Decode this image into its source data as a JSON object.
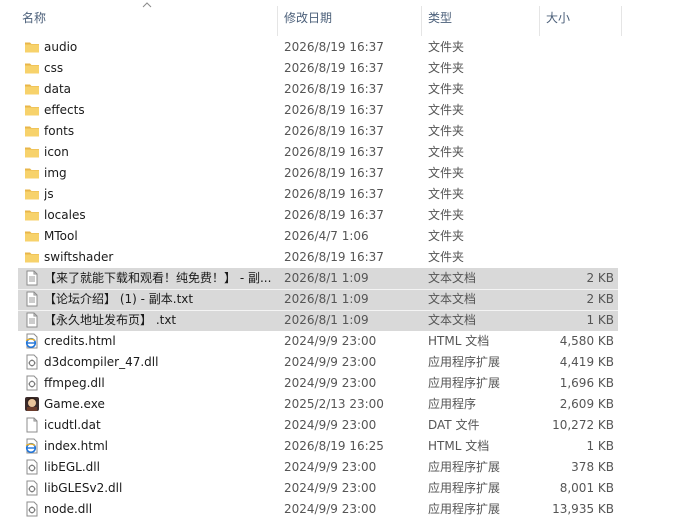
{
  "header": {
    "name": "名称",
    "date": "修改日期",
    "type": "类型",
    "size": "大小"
  },
  "rows": [
    {
      "name": "audio",
      "date": "2026/8/19 16:37",
      "type": "文件夹",
      "size": "",
      "icon": "folder-icon",
      "selected": false
    },
    {
      "name": "css",
      "date": "2026/8/19 16:37",
      "type": "文件夹",
      "size": "",
      "icon": "folder-icon",
      "selected": false
    },
    {
      "name": "data",
      "date": "2026/8/19 16:37",
      "type": "文件夹",
      "size": "",
      "icon": "folder-icon",
      "selected": false
    },
    {
      "name": "effects",
      "date": "2026/8/19 16:37",
      "type": "文件夹",
      "size": "",
      "icon": "folder-icon",
      "selected": false
    },
    {
      "name": "fonts",
      "date": "2026/8/19 16:37",
      "type": "文件夹",
      "size": "",
      "icon": "folder-icon",
      "selected": false
    },
    {
      "name": "icon",
      "date": "2026/8/19 16:37",
      "type": "文件夹",
      "size": "",
      "icon": "folder-icon",
      "selected": false
    },
    {
      "name": "img",
      "date": "2026/8/19 16:37",
      "type": "文件夹",
      "size": "",
      "icon": "folder-icon",
      "selected": false
    },
    {
      "name": "js",
      "date": "2026/8/19 16:37",
      "type": "文件夹",
      "size": "",
      "icon": "folder-icon",
      "selected": false
    },
    {
      "name": "locales",
      "date": "2026/8/19 16:37",
      "type": "文件夹",
      "size": "",
      "icon": "folder-icon",
      "selected": false
    },
    {
      "name": "MTool",
      "date": "2026/4/7 1:06",
      "type": "文件夹",
      "size": "",
      "icon": "folder-icon",
      "selected": false
    },
    {
      "name": "swiftshader",
      "date": "2026/8/19 16:37",
      "type": "文件夹",
      "size": "",
      "icon": "folder-icon",
      "selected": false
    },
    {
      "name": "【来了就能下载和观看！纯免费！】 - 副...",
      "date": "2026/8/1 1:09",
      "type": "文本文档",
      "size": "2 KB",
      "icon": "text-file-icon",
      "selected": true
    },
    {
      "name": "【论坛介绍】 (1) - 副本.txt",
      "date": "2026/8/1 1:09",
      "type": "文本文档",
      "size": "2 KB",
      "icon": "text-file-icon",
      "selected": true
    },
    {
      "name": "【永久地址发布页】 .txt",
      "date": "2026/8/1 1:09",
      "type": "文本文档",
      "size": "1 KB",
      "icon": "text-file-icon",
      "selected": true
    },
    {
      "name": "credits.html",
      "date": "2024/9/9 23:00",
      "type": "HTML 文档",
      "size": "4,580 KB",
      "icon": "html-file-icon",
      "selected": false
    },
    {
      "name": "d3dcompiler_47.dll",
      "date": "2024/9/9 23:00",
      "type": "应用程序扩展",
      "size": "4,419 KB",
      "icon": "dll-file-icon",
      "selected": false
    },
    {
      "name": "ffmpeg.dll",
      "date": "2024/9/9 23:00",
      "type": "应用程序扩展",
      "size": "1,696 KB",
      "icon": "dll-file-icon",
      "selected": false
    },
    {
      "name": "Game.exe",
      "date": "2025/2/13 23:00",
      "type": "应用程序",
      "size": "2,609 KB",
      "icon": "game-exe-icon",
      "selected": false
    },
    {
      "name": "icudtl.dat",
      "date": "2024/9/9 23:00",
      "type": "DAT 文件",
      "size": "10,272 KB",
      "icon": "blank-file-icon",
      "selected": false
    },
    {
      "name": "index.html",
      "date": "2026/8/19 16:25",
      "type": "HTML 文档",
      "size": "1 KB",
      "icon": "html-file-icon",
      "selected": false
    },
    {
      "name": "libEGL.dll",
      "date": "2024/9/9 23:00",
      "type": "应用程序扩展",
      "size": "378 KB",
      "icon": "dll-file-icon",
      "selected": false
    },
    {
      "name": "libGLESv2.dll",
      "date": "2024/9/9 23:00",
      "type": "应用程序扩展",
      "size": "8,001 KB",
      "icon": "dll-file-icon",
      "selected": false
    },
    {
      "name": "node.dll",
      "date": "2024/9/9 23:00",
      "type": "应用程序扩展",
      "size": "13,935 KB",
      "icon": "dll-file-icon",
      "selected": false
    }
  ]
}
